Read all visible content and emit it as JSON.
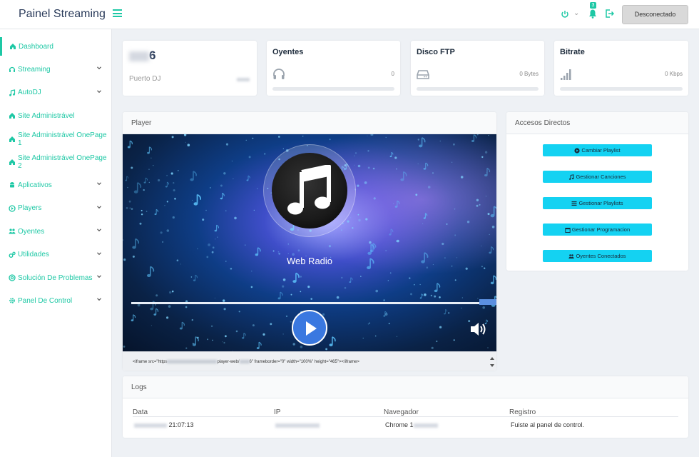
{
  "app": {
    "brand": "Painel Streaming",
    "disconnect_label": "Desconectado",
    "notification_count": "3"
  },
  "sidebar": {
    "items": [
      {
        "label": "Dashboard",
        "icon": "home-icon",
        "expandable": false,
        "active": true
      },
      {
        "label": "Streaming",
        "icon": "headphones-icon",
        "expandable": true
      },
      {
        "label": "AutoDJ",
        "icon": "music-icon",
        "expandable": true
      },
      {
        "label": "Site Administrável",
        "icon": "home-icon",
        "expandable": false
      },
      {
        "label": "Site Administrável OnePage 1",
        "icon": "home-icon",
        "expandable": false
      },
      {
        "label": "Site Administrável OnePage 2",
        "icon": "home-icon",
        "expandable": false
      },
      {
        "label": "Aplicativos",
        "icon": "android-icon",
        "expandable": true
      },
      {
        "label": "Players",
        "icon": "play-circle-icon",
        "expandable": true
      },
      {
        "label": "Oyentes",
        "icon": "users-icon",
        "expandable": true
      },
      {
        "label": "Utilidades",
        "icon": "cogs-icon",
        "expandable": true
      },
      {
        "label": "Solución De Problemas",
        "icon": "lifebuoy-icon",
        "expandable": true
      },
      {
        "label": "Panel De Control",
        "icon": "gear-icon",
        "expandable": true
      }
    ]
  },
  "stats": {
    "port": {
      "value_suffix": "6",
      "label": "Puerto DJ"
    },
    "listeners": {
      "title": "Oyentes",
      "value": "0",
      "icon": "headphones-icon"
    },
    "ftp": {
      "title": "Disco FTP",
      "value": "0 Bytes",
      "icon": "hard-drive-icon"
    },
    "bitrate": {
      "title": "Bitrate",
      "value": "0 Kbps",
      "icon": "signal-icon"
    }
  },
  "player": {
    "title": "Player",
    "station_name": "Web Radio",
    "embed_prefix": "<iframe src=\"https",
    "embed_mid": "player-web/",
    "embed_mid2": "6\" frameborder=\"0\" width=\"100%\" height=\"465\"></iframe>"
  },
  "shortcuts": {
    "title": "Accesos Directos",
    "buttons": [
      {
        "label": "Cambiar Playlist",
        "icon": "play-circle-icon"
      },
      {
        "label": "Gestionar Canciones",
        "icon": "music-icon"
      },
      {
        "label": "Gestionar Playlists",
        "icon": "list-icon"
      },
      {
        "label": "Gestionar Programacion",
        "icon": "calendar-icon"
      },
      {
        "label": "Oyentes Conectados",
        "icon": "users-icon"
      }
    ]
  },
  "logs": {
    "title": "Logs",
    "columns": [
      "Data",
      "IP",
      "Navegador",
      "Registro"
    ],
    "rows": [
      {
        "date_suffix": "21:07:13",
        "browser": "Chrome 1",
        "registro": "Fuiste al panel de control."
      }
    ]
  },
  "colors": {
    "accent": "#1ec8a5",
    "shortcut_button": "#14d2f2",
    "play_button": "#3a78e0"
  }
}
